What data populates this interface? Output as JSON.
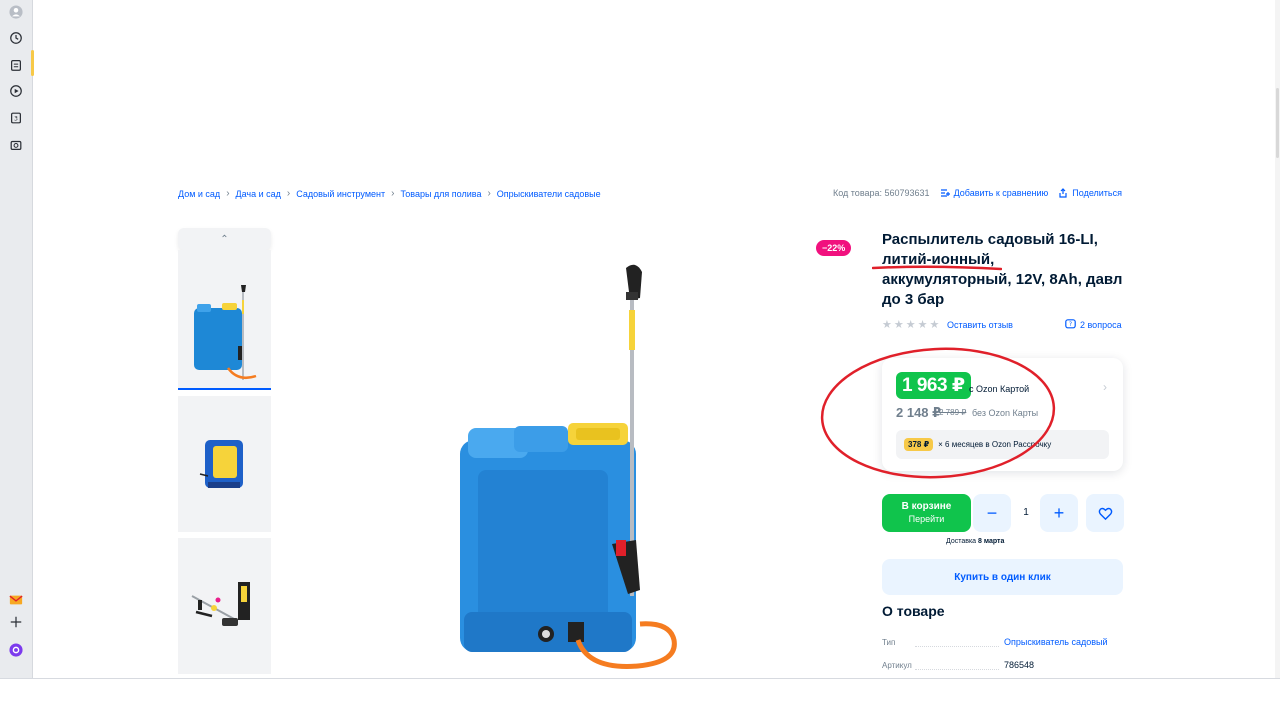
{
  "browser": {
    "side_icons": [
      "avatar-icon",
      "history-icon",
      "collections-icon",
      "video-icon",
      "notes-icon",
      "screenshot-icon",
      "mail-icon",
      "add-icon",
      "alice-icon"
    ]
  },
  "breadcrumbs": [
    "Дом и сад",
    "Дача и сад",
    "Садовый инструмент",
    "Товары для полива",
    "Опрыскиватели садовые"
  ],
  "header_actions": {
    "code": "Код товара: 560793631",
    "compare": "Добавить к сравнению",
    "share": "Поделиться"
  },
  "product": {
    "discount": "−22%",
    "title": "Распылитель садовый 16-LI, литий-ионный, аккумуляторный, 12V, 8Ah, давл до 3 бар",
    "review_link": "Оставить отзыв",
    "questions": "2 вопроса",
    "rating_stars": 0
  },
  "price": {
    "card_price": "1 963 ₽",
    "card_label": "с Ozon Картой",
    "regular_price": "2 148 ₽",
    "old_price": "2 789 ₽",
    "regular_label": "без Ozon Карты",
    "installment_amount": "378 ₽",
    "installment_text": "× 6 месяцев в Ozon Рассрочку"
  },
  "cart": {
    "in_cart": "В корзине",
    "go": "Перейти",
    "quantity": "1",
    "delivery_label": "Доставка",
    "delivery_date": "8 марта",
    "one_click": "Купить в один клик"
  },
  "about": {
    "title": "О товаре",
    "specs": [
      {
        "label": "Тип",
        "value": "Опрыскиватель садовый"
      },
      {
        "label": "Артикул",
        "value": "786548"
      }
    ]
  },
  "colors": {
    "ozon_blue": "#005bff",
    "green": "#10c44c",
    "badge_pink": "#f1117e",
    "annotation_red": "#e0202a"
  }
}
